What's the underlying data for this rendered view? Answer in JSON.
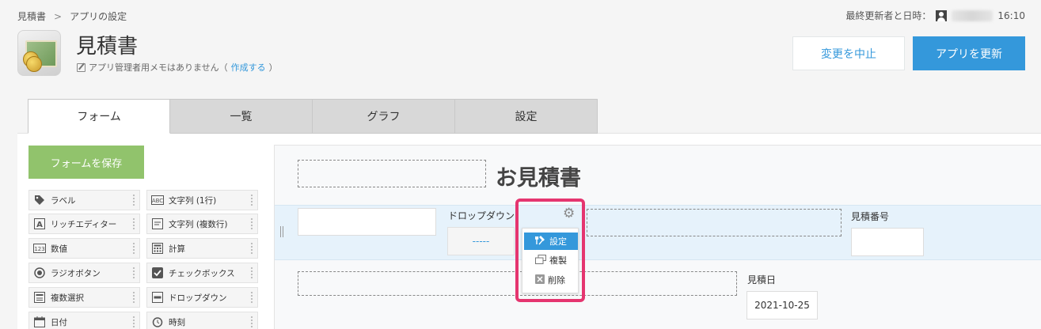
{
  "breadcrumb": {
    "app": "見積書",
    "separator": ">",
    "current": "アプリの設定"
  },
  "updater": {
    "label": "最終更新者と日時：",
    "time": "16:10"
  },
  "app": {
    "title": "見積書",
    "memo_text": "アプリ管理者用メモはありません（",
    "memo_link": "作成する",
    "memo_close": "）"
  },
  "actions": {
    "cancel": "変更を中止",
    "update": "アプリを更新"
  },
  "tabs": [
    {
      "label": "フォーム",
      "active": true
    },
    {
      "label": "一覧",
      "active": false
    },
    {
      "label": "グラフ",
      "active": false
    },
    {
      "label": "設定",
      "active": false
    }
  ],
  "sidebar": {
    "save_button": "フォームを保存",
    "fields": [
      {
        "label": "ラベル",
        "icon": "tag-icon"
      },
      {
        "label": "文字列 (1行)",
        "icon": "abc-icon"
      },
      {
        "label": "リッチエディター",
        "icon": "letter-a-icon"
      },
      {
        "label": "文字列 (複数行)",
        "icon": "multiline-text-icon"
      },
      {
        "label": "数値",
        "icon": "number-123-icon"
      },
      {
        "label": "計算",
        "icon": "calculator-icon"
      },
      {
        "label": "ラジオボタン",
        "icon": "radio-icon"
      },
      {
        "label": "チェックボックス",
        "icon": "checkbox-icon"
      },
      {
        "label": "複数選択",
        "icon": "multi-select-icon"
      },
      {
        "label": "ドロップダウン",
        "icon": "dropdown-icon"
      },
      {
        "label": "日付",
        "icon": "calendar-icon"
      },
      {
        "label": "時刻",
        "icon": "clock-icon"
      }
    ]
  },
  "form": {
    "title": "お見積書",
    "dropdown_label": "ドロップダウン",
    "dropdown_value": "-----",
    "estimate_number_label": "見積番号",
    "estimate_date_label": "見積日",
    "estimate_date_value": "2021-10-25"
  },
  "context_menu": {
    "items": [
      {
        "label": "設定",
        "icon": "settings-icon",
        "selected": true
      },
      {
        "label": "複製",
        "icon": "duplicate-icon",
        "selected": false
      },
      {
        "label": "削除",
        "icon": "delete-icon",
        "selected": false
      }
    ]
  },
  "colors": {
    "primary": "#3498db",
    "save": "#91c36c",
    "highlight": "#e5356f"
  }
}
